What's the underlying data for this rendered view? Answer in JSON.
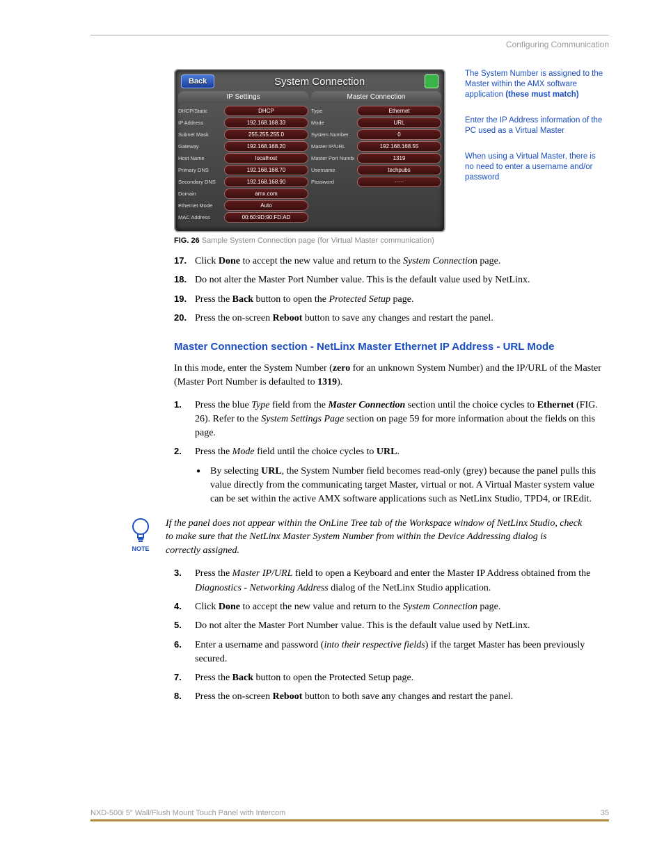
{
  "header": {
    "section": "Configuring Communication"
  },
  "panel": {
    "back": "Back",
    "title": "System Connection",
    "left_head": "IP Settings",
    "right_head": "Master Connection",
    "left_rows": [
      {
        "label": "DHCP/Static",
        "value": "DHCP"
      },
      {
        "label": "IP Address",
        "value": "192.168.168.33"
      },
      {
        "label": "Subnet Mask",
        "value": "255.255.255.0"
      },
      {
        "label": "Gateway",
        "value": "192.168.168.20"
      },
      {
        "label": "Host Name",
        "value": "localhost"
      },
      {
        "label": "Primary DNS",
        "value": "192.168.168.70"
      },
      {
        "label": "Secondary DNS",
        "value": "192.168.168.90"
      },
      {
        "label": "Domain",
        "value": "amx.com"
      },
      {
        "label": "Ethernet Mode",
        "value": "Auto"
      },
      {
        "label": "MAC Address",
        "value": "00:60:9D:90:FD:AD"
      }
    ],
    "right_rows": [
      {
        "label": "Type",
        "value": "Ethernet"
      },
      {
        "label": "Mode",
        "value": "URL"
      },
      {
        "label": "System Number",
        "value": "0"
      },
      {
        "label": "Master IP/URL",
        "value": "192.168.168.55"
      },
      {
        "label": "Master Port Number",
        "value": "1319"
      },
      {
        "label": "Username",
        "value": "techpubs"
      },
      {
        "label": "Password",
        "value": "·····"
      }
    ]
  },
  "callouts": {
    "c1a": "The System Number is assigned to the Master within the AMX software application",
    "c1b": "(these must match)",
    "c2": "Enter the IP Address information of the PC used as a Virtual Master",
    "c3": "When using a Virtual Master, there is no need to enter a username and/or password"
  },
  "figcap": {
    "bold": "FIG. 26",
    "rest": "  Sample System Connection page (for Virtual Master communication)"
  },
  "steps1": [
    {
      "n": "17.",
      "pre": "Click ",
      "b1": "Done",
      "mid": " to accept the new value and return to the ",
      "i1": "System Connectio",
      "post": "n page."
    },
    {
      "n": "18.",
      "txt": "Do not alter the Master Port Number value. This is the default value used by NetLinx."
    },
    {
      "n": "19.",
      "pre": "Press the ",
      "b1": "Back",
      "mid": " button to open the ",
      "i1": "Protected Setup",
      "post": " page."
    },
    {
      "n": "20.",
      "pre": "Press the on-screen ",
      "b1": "Reboot",
      "post": " button to save any changes and restart the panel."
    }
  ],
  "section_head": "Master Connection section - NetLinx Master Ethernet IP Address - URL Mode",
  "intro": {
    "a": "In this mode, enter the System Number (",
    "b": "zero",
    "c": " for an unknown System Number) and the IP/URL of the Master (Master Port Number is defaulted to ",
    "d": "1319",
    "e": ")."
  },
  "steps2": [
    {
      "n": "1.",
      "parts": [
        "Press the blue ",
        {
          "i": "Type"
        },
        " field from the ",
        {
          "bi": "Master Connection"
        },
        " section until the choice cycles to ",
        {
          "b": "Ethernet"
        },
        " (FIG. 26). Refer to the ",
        {
          "i": "System Settings Page"
        },
        " section on page 59 for more information about the fields on this page."
      ]
    },
    {
      "n": "2.",
      "parts": [
        "Press the ",
        {
          "i": "Mode"
        },
        " field until the choice cycles to ",
        {
          "b": "URL"
        },
        "."
      ]
    }
  ],
  "bullet": {
    "a": "By selecting ",
    "b": "URL",
    "c": ", the System Number field becomes read-only (grey) because the panel pulls this value directly from the communicating target Master, virtual or not. A Virtual Master system value can be set within the active AMX software applications such as NetLinx Studio, TPD4, or IREdit."
  },
  "note_label": "NOTE",
  "note": "If the panel does not appear within the OnLine Tree tab of the Workspace window of NetLinx Studio, check to make sure that the NetLinx Master System Number from within the Device Addressing dialog is correctly assigned.",
  "steps3": [
    {
      "n": "3.",
      "parts": [
        "Press the ",
        {
          "i": "Master IP/URL"
        },
        " field to open a Keyboard and enter the Master IP Address obtained from the ",
        {
          "i": "Diagnostics - Networking Address"
        },
        " dialog of the NetLinx Studio application."
      ]
    },
    {
      "n": "4.",
      "parts": [
        "Click ",
        {
          "b": "Done"
        },
        " to accept the new value and return to the ",
        {
          "i": "System Connection"
        },
        " page."
      ]
    },
    {
      "n": "5.",
      "parts": [
        "Do not alter the Master Port Number value. This is the default value used by NetLinx."
      ]
    },
    {
      "n": "6.",
      "parts": [
        "Enter a username and password (",
        {
          "i": "into their respective fields"
        },
        ") if the target Master has been previously secured."
      ]
    },
    {
      "n": "7.",
      "parts": [
        "Press the ",
        {
          "b": "Back"
        },
        " button to open the Protected Setup page."
      ]
    },
    {
      "n": "8.",
      "parts": [
        "Press the on-screen ",
        {
          "b": "Reboot"
        },
        " button to both save any changes and restart the panel."
      ]
    }
  ],
  "footer": {
    "left": "NXD-500i 5\" Wall/Flush Mount Touch Panel with Intercom",
    "right": "35"
  }
}
